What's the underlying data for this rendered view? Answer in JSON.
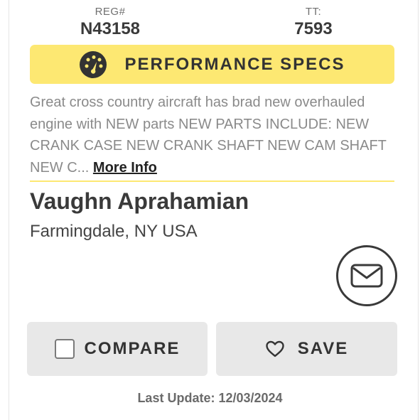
{
  "stats": {
    "reg": {
      "label": "REG#",
      "value": "N43158"
    },
    "tt": {
      "label": "TT:",
      "value": "7593"
    }
  },
  "specs_button": {
    "label": "PERFORMANCE SPECS",
    "icon": "speedometer-icon"
  },
  "description": {
    "text": "Great cross country aircraft has brad new overhauled engine with NEW parts NEW PARTS INCLUDE: NEW CRANK CASE NEW CRANK SHAFT NEW CAM SHAFT NEW C...",
    "more_link": "More Info"
  },
  "seller": {
    "name": "Vaughn Aprahamian",
    "location": "Farmingdale, NY USA"
  },
  "contact": {
    "icon": "envelope-icon"
  },
  "actions": {
    "compare_label": "COMPARE",
    "save_label": "SAVE"
  },
  "footer": {
    "last_update": "Last Update: 12/03/2024"
  },
  "colors": {
    "accent_yellow": "#fde872",
    "button_gray": "#e8e8e8",
    "text_dark": "#333333"
  }
}
